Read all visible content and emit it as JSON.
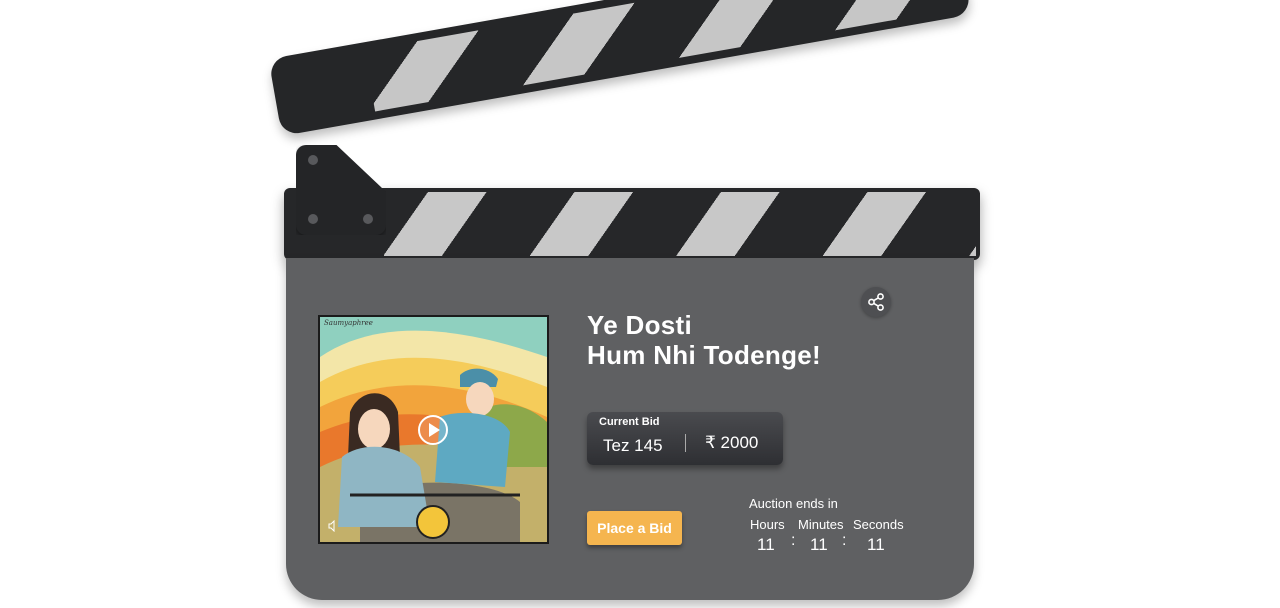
{
  "artwork": {
    "signature": "Saumyaphree",
    "play_icon": "play-circle-icon",
    "mute_icon": "speaker-mute-icon"
  },
  "title": {
    "line1": "Ye Dosti",
    "line2": "Hum Nhi Todenge!"
  },
  "share_icon": "share-icon",
  "bid": {
    "label": "Current Bid",
    "user": "Tez 145",
    "amount": "₹ 2000"
  },
  "place_bid_label": "Place a Bid",
  "auction": {
    "heading": "Auction ends in",
    "hours_label": "Hours",
    "minutes_label": "Minutes",
    "seconds_label": "Seconds",
    "hours": "11",
    "minutes": "11",
    "seconds": "11",
    "separator": ":"
  },
  "colors": {
    "board": "#5f6062",
    "clapper": "#252628",
    "stripe": "#c6c6c6",
    "accent": "#f5b54f"
  }
}
